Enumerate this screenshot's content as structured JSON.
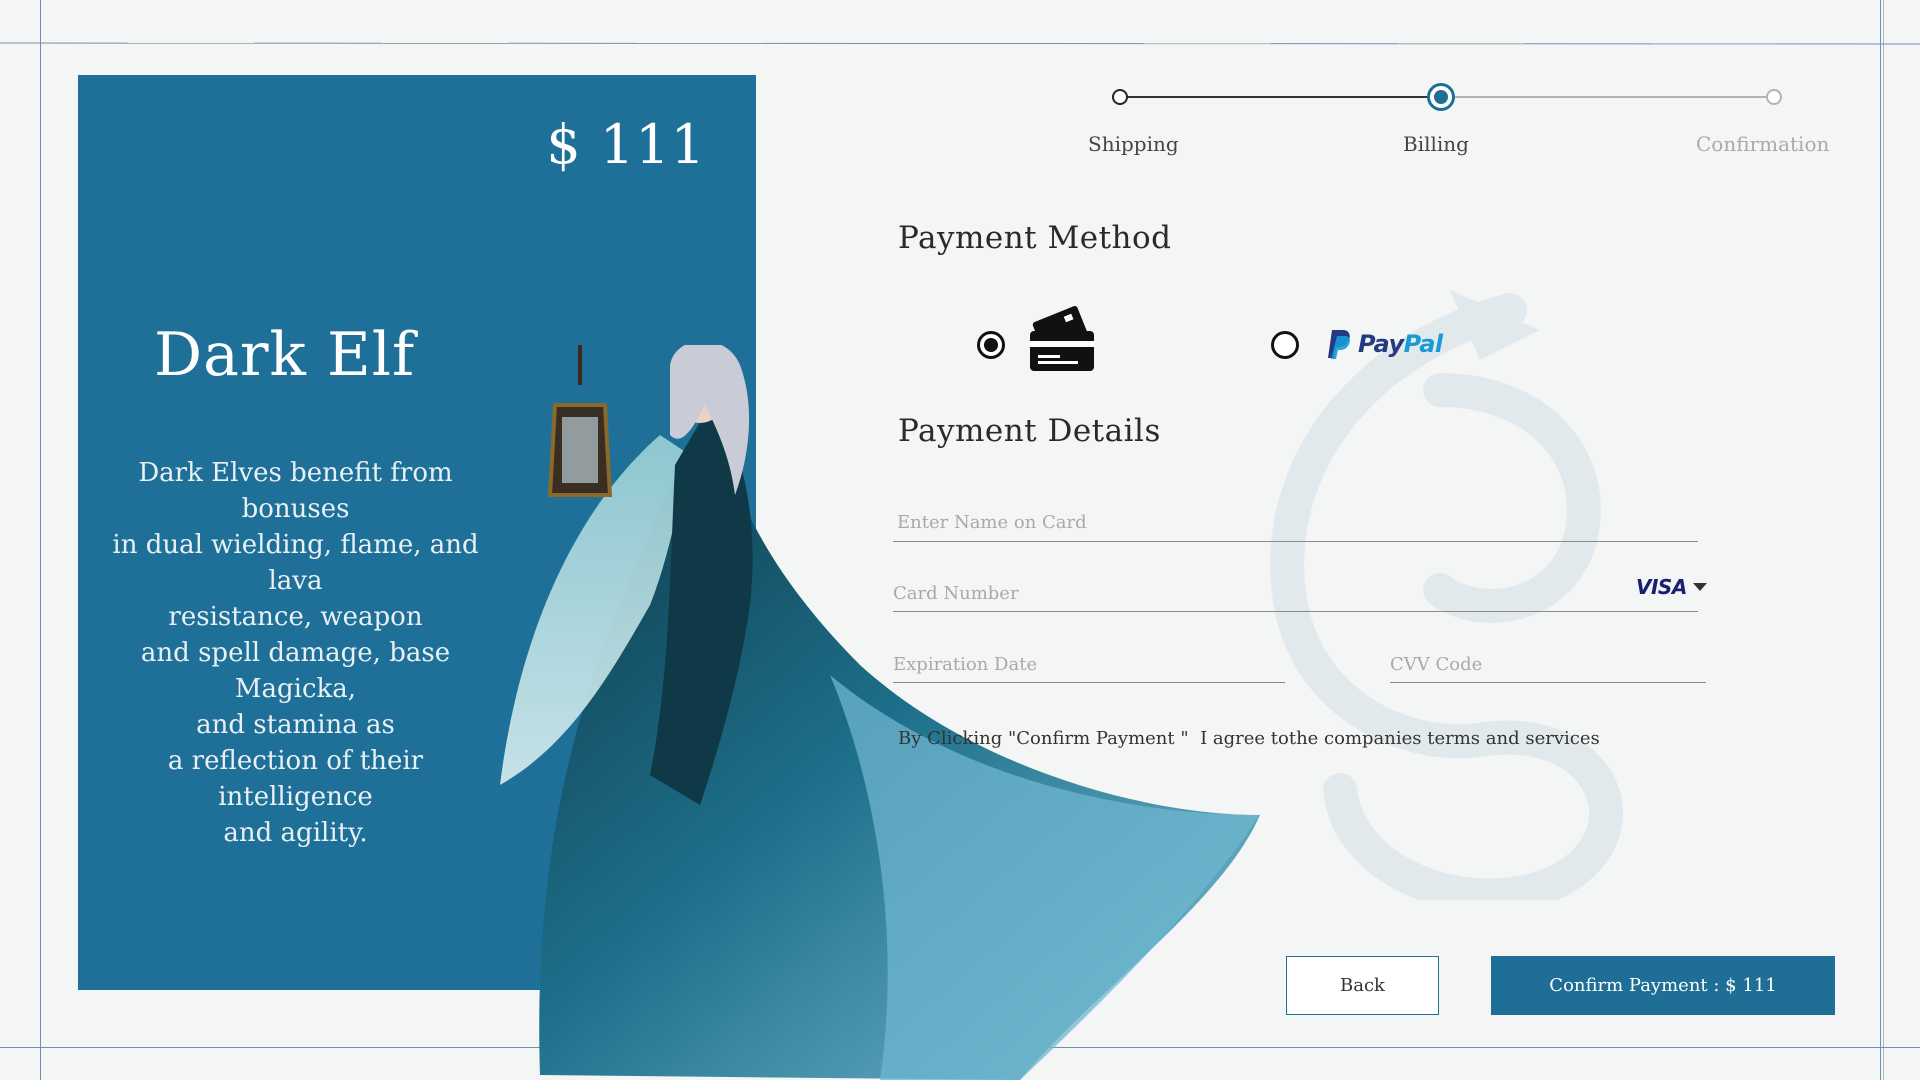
{
  "product": {
    "price": "$ 111",
    "title": "Dark Elf",
    "description": "Dark Elves benefit from bonuses\n in dual wielding, flame, and lava\nresistance, weapon\nand spell damage, base Magicka,\nand stamina as\n a reflection of their intelligence\nand agility."
  },
  "stepper": {
    "steps": [
      {
        "label": "Shipping",
        "state": "complete"
      },
      {
        "label": "Billing",
        "state": "active"
      },
      {
        "label": "Confirmation",
        "state": "pending"
      }
    ]
  },
  "payment_method": {
    "title": "Payment Method",
    "options": [
      {
        "id": "card",
        "icon": "credit-card-icon",
        "selected": true
      },
      {
        "id": "paypal",
        "label_pay": "Pay",
        "label_pal": "Pal",
        "icon": "paypal-logo",
        "selected": false
      }
    ]
  },
  "payment_details": {
    "title": "Payment Details",
    "name_placeholder": "Enter Name on Card",
    "card_placeholder": "Card Number",
    "card_brand": "VISA",
    "expiration_placeholder": "Expiration Date",
    "cvv_placeholder": "CVV Code"
  },
  "terms": "By Clicking \"Confirm Payment \"  I agree tothe companies terms and services",
  "buttons": {
    "back": "Back",
    "confirm": "Confirm Payment : $ 111"
  },
  "colors": {
    "accent": "#1e6e95",
    "panel": "#1e7099",
    "background": "#f4f5f5",
    "paypal_dark": "#253b80",
    "paypal_light": "#179bd7",
    "visa": "#1a1f71"
  }
}
